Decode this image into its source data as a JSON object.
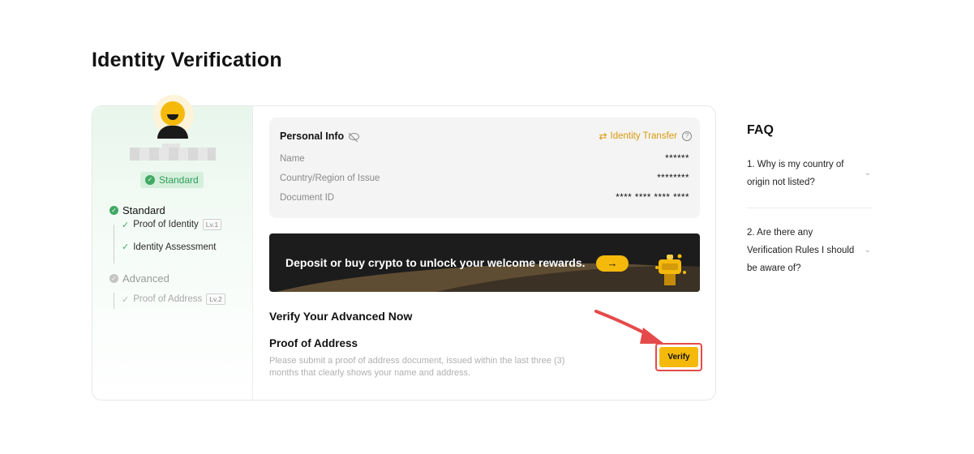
{
  "page": {
    "title": "Identity Verification"
  },
  "sidebar": {
    "badge_label": "Standard",
    "levels": [
      {
        "label": "Standard",
        "status": "completed",
        "items": [
          {
            "label": "Proof of Identity",
            "tag": "Lv.1",
            "done": true
          },
          {
            "label": "Identity Assessment",
            "tag": "",
            "done": true
          }
        ]
      },
      {
        "label": "Advanced",
        "status": "pending",
        "items": [
          {
            "label": "Proof of Address",
            "tag": "Lv.2",
            "done": false
          }
        ]
      }
    ]
  },
  "personal_info": {
    "title": "Personal Info",
    "transfer_label": "Identity Transfer",
    "rows": [
      {
        "label": "Name",
        "value": "******"
      },
      {
        "label": "Country/Region of Issue",
        "value": "********"
      },
      {
        "label": "Document ID",
        "value": "**** **** **** ****"
      }
    ]
  },
  "banner": {
    "text": "Deposit or buy crypto to unlock your welcome rewards.",
    "arrow": "→"
  },
  "verify_section": {
    "heading": "Verify Your Advanced Now",
    "poa_title": "Proof of Address",
    "poa_description": "Please submit a proof of address document, issued within the last three (3) months that clearly shows your name and address.",
    "verify_label": "Verify"
  },
  "faq": {
    "title": "FAQ",
    "items": [
      {
        "question": "1. Why is my country of origin not listed?"
      },
      {
        "question": "2. Are there any Verification Rules I should be aware of?"
      }
    ]
  },
  "colors": {
    "accent": "#f5b90c",
    "success": "#3fa964",
    "highlight": "#e54a4a"
  },
  "icons": [
    "avatar",
    "shield-check-icon",
    "check-circle-icon",
    "check-icon",
    "eye-off-icon",
    "transfer-icon",
    "help-icon",
    "arrow-right-icon",
    "gift-icon",
    "chevron-down-icon"
  ]
}
